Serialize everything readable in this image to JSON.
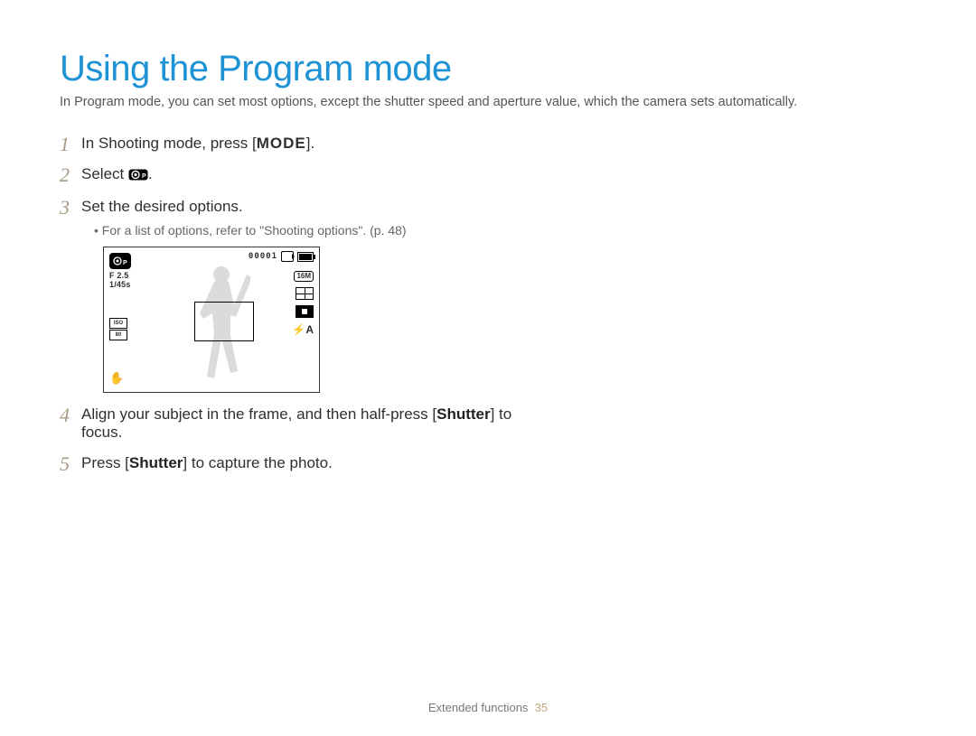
{
  "title": "Using the Program mode",
  "intro": "In Program mode, you can set most options, except the shutter speed and aperture value, which the camera sets automatically.",
  "steps": {
    "s1": {
      "num": "1",
      "pre": "In Shooting mode, press [",
      "mode": "MODE",
      "post": "]."
    },
    "s2": {
      "num": "2",
      "pre": "Select ",
      "post": "."
    },
    "s3": {
      "num": "3",
      "text": "Set the desired options.",
      "bullet": "For a list of options, refer to \"Shooting options\". (p. 48)"
    },
    "s4": {
      "num": "4",
      "pre": "Align your subject in the frame, and then half-press [",
      "bold": "Shutter",
      "post": "] to focus."
    },
    "s5": {
      "num": "5",
      "pre": "Press [",
      "bold": "Shutter",
      "post": "] to capture the photo."
    }
  },
  "lcd": {
    "mode_icon": "P",
    "aperture": "F 2.5",
    "shutter": "1/45s",
    "iso_label": "ISO",
    "iso_value": "80",
    "counter": "00001",
    "size_pill": "16M",
    "flash": "⚡A"
  },
  "footer": {
    "section": "Extended functions",
    "page": "35"
  }
}
